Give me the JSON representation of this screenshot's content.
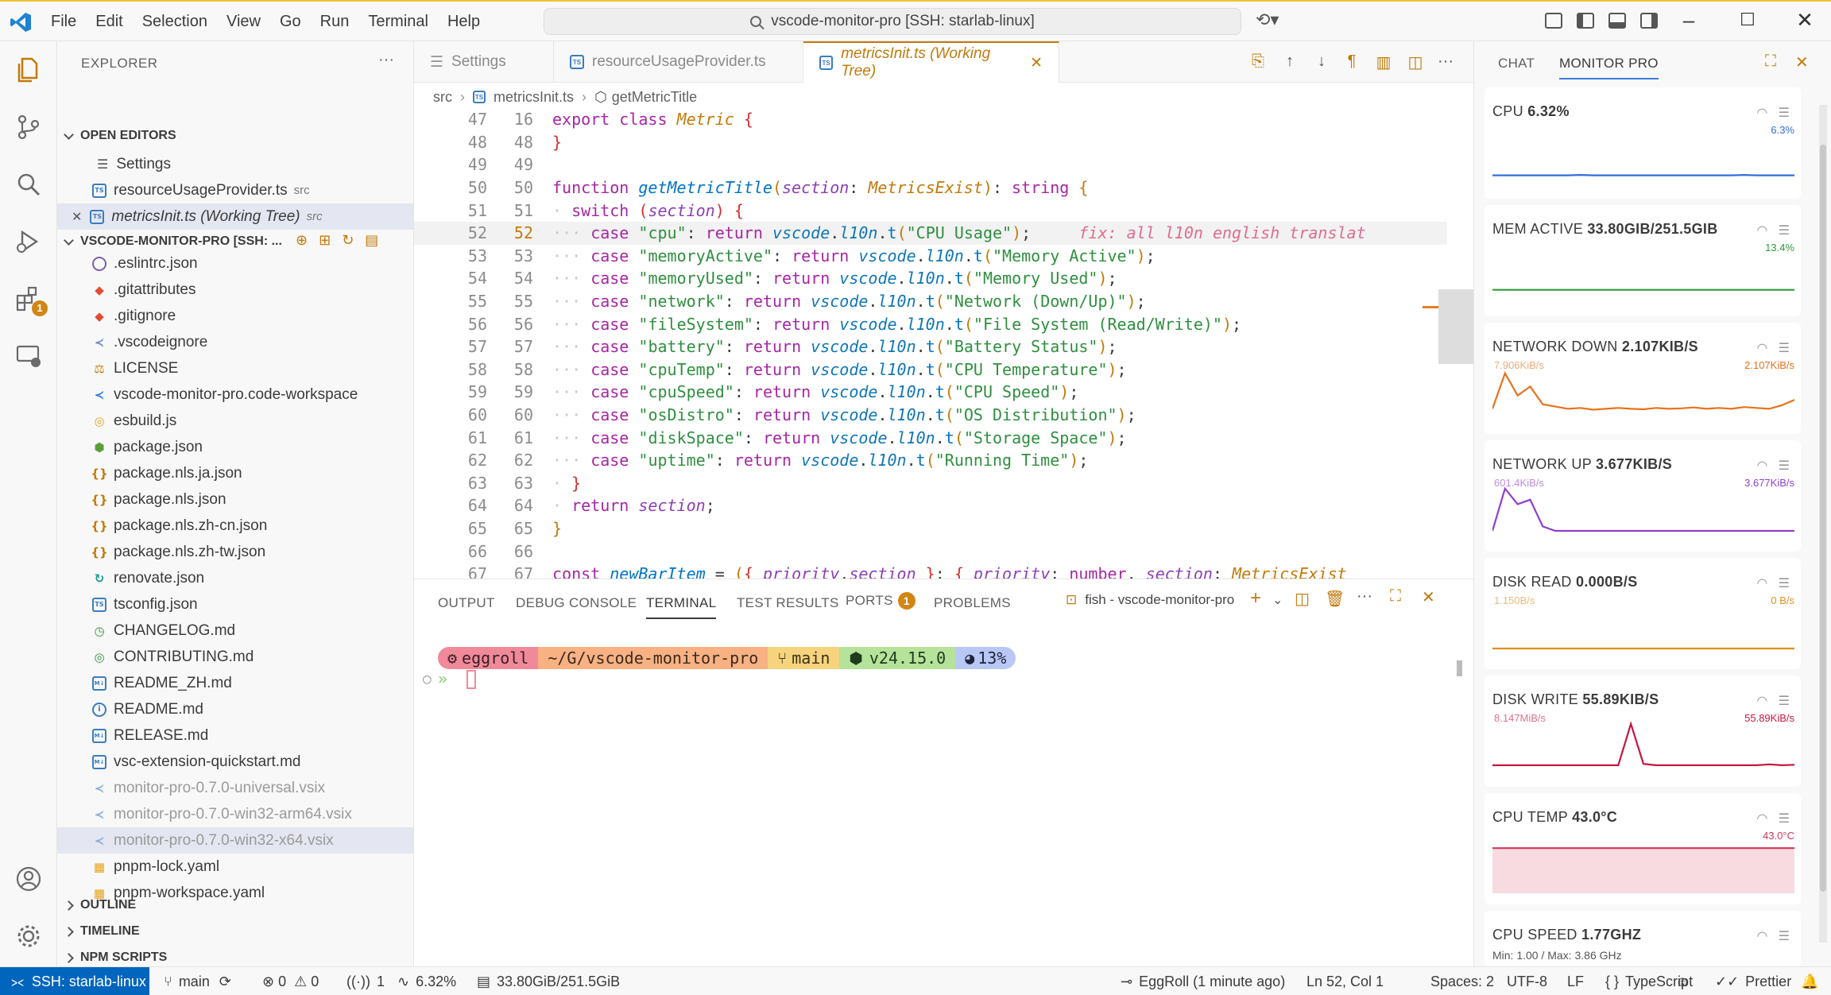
{
  "titlebar": {
    "menu": [
      "File",
      "Edit",
      "Selection",
      "View",
      "Go",
      "Run",
      "Terminal",
      "Help"
    ],
    "command_center": "vscode-monitor-pro [SSH: starlab-linux]"
  },
  "activity": {
    "extensions_badge": "1"
  },
  "explorer": {
    "title": "EXPLORER",
    "open_editors_label": "OPEN EDITORS",
    "open_editors": [
      {
        "name": "Settings",
        "desc": ""
      },
      {
        "name": "resourceUsageProvider.ts",
        "desc": "src"
      },
      {
        "name": "metricsInit.ts (Working Tree)",
        "desc": "src"
      }
    ],
    "workspace_label": "VSCODE-MONITOR-PRO [SSH: ...",
    "files": [
      {
        "name": ".eslintrc.json",
        "icon": "eslint-icon",
        "glyph": "",
        "color": "#7b5ea7"
      },
      {
        "name": ".gitattributes",
        "icon": "git-icon",
        "glyph": "◆",
        "color": "#e44c30"
      },
      {
        "name": ".gitignore",
        "icon": "git-icon",
        "glyph": "◆",
        "color": "#e44c30"
      },
      {
        "name": ".vscodeignore",
        "icon": "vscode-icon",
        "glyph": "≺",
        "color": "#6c8ebf"
      },
      {
        "name": "LICENSE",
        "icon": "license-icon",
        "glyph": "⚖",
        "color": "#c27a0a"
      },
      {
        "name": "vscode-monitor-pro.code-workspace",
        "icon": "vscode-icon",
        "glyph": "≺",
        "color": "#2f7fd8"
      },
      {
        "name": "esbuild.js",
        "icon": "esbuild-icon",
        "glyph": "◎",
        "color": "#e3a21a"
      },
      {
        "name": "package.json",
        "icon": "nodejs-icon",
        "glyph": "⬢",
        "color": "#5a9e3a"
      },
      {
        "name": "package.nls.ja.json",
        "icon": "json-icon",
        "glyph": "{}",
        "color": "#c27a0a"
      },
      {
        "name": "package.nls.json",
        "icon": "json-icon",
        "glyph": "{}",
        "color": "#c27a0a"
      },
      {
        "name": "package.nls.zh-cn.json",
        "icon": "json-icon",
        "glyph": "{}",
        "color": "#c27a0a"
      },
      {
        "name": "package.nls.zh-tw.json",
        "icon": "json-icon",
        "glyph": "{}",
        "color": "#c27a0a"
      },
      {
        "name": "renovate.json",
        "icon": "renovate-icon",
        "glyph": "↻",
        "color": "#1a9b8f"
      },
      {
        "name": "tsconfig.json",
        "icon": "ts-icon",
        "glyph": "TS",
        "color": "#3a7dbf"
      },
      {
        "name": "CHANGELOG.md",
        "icon": "changelog-icon",
        "glyph": "◷",
        "color": "#2f8f3f"
      },
      {
        "name": "CONTRIBUTING.md",
        "icon": "contributing-icon",
        "glyph": "◎",
        "color": "#2f8f3f"
      },
      {
        "name": "README_ZH.md",
        "icon": "markdown-icon",
        "glyph": "M↓",
        "color": "#3a7dbf"
      },
      {
        "name": "README.md",
        "icon": "info-icon",
        "glyph": "i",
        "color": "#3a7dbf"
      },
      {
        "name": "RELEASE.md",
        "icon": "markdown-icon",
        "glyph": "M↓",
        "color": "#3a7dbf"
      },
      {
        "name": "vsc-extension-quickstart.md",
        "icon": "markdown-icon",
        "glyph": "M↓",
        "color": "#3a7dbf"
      },
      {
        "name": "monitor-pro-0.7.0-universal.vsix",
        "icon": "vscode-icon",
        "glyph": "≺",
        "color": "#8aaed6",
        "dim": true
      },
      {
        "name": "monitor-pro-0.7.0-win32-arm64.vsix",
        "icon": "vscode-icon",
        "glyph": "≺",
        "color": "#8aaed6",
        "dim": true
      },
      {
        "name": "monitor-pro-0.7.0-win32-x64.vsix",
        "icon": "vscode-icon",
        "glyph": "≺",
        "color": "#8aaed6",
        "dim": true,
        "selected": true
      },
      {
        "name": "pnpm-lock.yaml",
        "icon": "pnpm-icon",
        "glyph": "▦",
        "color": "#e3a21a"
      },
      {
        "name": "pnpm-workspace.yaml",
        "icon": "pnpm-icon",
        "glyph": "▦",
        "color": "#e3a21a"
      }
    ],
    "outline": "OUTLINE",
    "timeline": "TIMELINE",
    "npm_scripts": "NPM SCRIPTS"
  },
  "tabs": [
    {
      "label": "Settings",
      "active": false
    },
    {
      "label": "resourceUsageProvider.ts",
      "active": false
    },
    {
      "label": "metricsInit.ts (Working Tree)",
      "active": true
    }
  ],
  "breadcrumb": [
    "src",
    "metricsInit.ts",
    "getMetricTitle"
  ],
  "code": {
    "left_numbers": [
      "47",
      "48",
      "49",
      "50",
      "51",
      "52",
      "53",
      "54",
      "55",
      "56",
      "57",
      "58",
      "59",
      "60",
      "61",
      "62",
      "63",
      "64",
      "65",
      "66",
      "67"
    ],
    "right_numbers": [
      "16",
      "48",
      "49",
      "50",
      "51",
      "52",
      "53",
      "54",
      "55",
      "56",
      "57",
      "58",
      "59",
      "60",
      "61",
      "62",
      "63",
      "64",
      "65",
      "66",
      "67"
    ],
    "cases": [
      {
        "key": "\"cpu\"",
        "label": "\"CPU Usage\""
      },
      {
        "key": "\"memoryActive\"",
        "label": "\"Memory Active\""
      },
      {
        "key": "\"memoryUsed\"",
        "label": "\"Memory Used\""
      },
      {
        "key": "\"network\"",
        "label": "\"Network (Down/Up)\""
      },
      {
        "key": "\"fileSystem\"",
        "label": "\"File System (Read/Write)\""
      },
      {
        "key": "\"battery\"",
        "label": "\"Battery Status\""
      },
      {
        "key": "\"cpuTemp\"",
        "label": "\"CPU Temperature\""
      },
      {
        "key": "\"cpuSpeed\"",
        "label": "\"CPU Speed\""
      },
      {
        "key": "\"osDistro\"",
        "label": "\"OS Distribution\""
      },
      {
        "key": "\"diskSpace\"",
        "label": "\"Storage Space\""
      },
      {
        "key": "\"uptime\"",
        "label": "\"Running Time\""
      }
    ],
    "inline_hint": "fix: all l10n english translat"
  },
  "panel": {
    "tabs": [
      "OUTPUT",
      "DEBUG CONSOLE",
      "TERMINAL",
      "TEST RESULTS",
      "PORTS",
      "PROBLEMS"
    ],
    "active_tab": "TERMINAL",
    "ports_badge": "1",
    "terminal_name": "fish - vscode-monitor-pro",
    "prompt": {
      "user": "eggroll",
      "path": "~/G/vscode-monitor-pro",
      "branch": "main",
      "node": "v24.15.0",
      "battery": "13%"
    }
  },
  "aux": {
    "tabs": [
      "CHAT",
      "MONITOR PRO"
    ],
    "metrics": [
      {
        "name": "CPU",
        "value": "6.32%",
        "left": "",
        "right": "6.3%",
        "color": "#2f6fdb",
        "series": [
          0.06,
          0.06,
          0.06,
          0.06,
          0.06,
          0.06,
          0.06,
          0.07,
          0.06,
          0.06,
          0.06,
          0.06,
          0.06,
          0.06,
          0.06,
          0.06,
          0.06,
          0.06,
          0.06,
          0.06,
          0.07,
          0.06,
          0.06,
          0.06,
          0.06
        ]
      },
      {
        "name": "MEM ACTIVE",
        "value": "33.80GIB/251.5GIB",
        "left": "",
        "right": "13.4%",
        "color": "#2f9a3a",
        "series": [
          0.13,
          0.13,
          0.13,
          0.13,
          0.13,
          0.13,
          0.13,
          0.13,
          0.13,
          0.13,
          0.13,
          0.13,
          0.13,
          0.13,
          0.13,
          0.13,
          0.13,
          0.13,
          0.13,
          0.13,
          0.13,
          0.13,
          0.13,
          0.13,
          0.13
        ]
      },
      {
        "name": "NETWORK DOWN",
        "value": "2.107KIB/S",
        "left": "7.906KiB/s",
        "right": "2.107KiB/s",
        "color": "#e8711c",
        "series": [
          0.1,
          0.9,
          0.4,
          0.6,
          0.2,
          0.15,
          0.1,
          0.12,
          0.08,
          0.1,
          0.12,
          0.1,
          0.09,
          0.12,
          0.1,
          0.11,
          0.13,
          0.1,
          0.12,
          0.1,
          0.14,
          0.12,
          0.1,
          0.18,
          0.3
        ]
      },
      {
        "name": "NETWORK UP",
        "value": "3.677KIB/S",
        "left": "601.4KiB/s",
        "right": "3.677KiB/s",
        "color": "#8e3fd0",
        "series": [
          0.0,
          0.95,
          0.6,
          0.7,
          0.1,
          0.0,
          0.0,
          0.0,
          0.0,
          0.0,
          0.0,
          0.0,
          0.0,
          0.0,
          0.0,
          0.0,
          0.0,
          0.0,
          0.0,
          0.0,
          0.0,
          0.0,
          0.0,
          0.0,
          0.0
        ]
      },
      {
        "name": "DISK READ",
        "value": "0.000B/S",
        "left": "1.150B/s",
        "right": "0 B/s",
        "color": "#e0901c",
        "series": [
          0,
          0,
          0,
          0,
          0,
          0,
          0,
          0,
          0,
          0,
          0,
          0,
          0,
          0,
          0,
          0,
          0,
          0,
          0,
          0,
          0,
          0,
          0,
          0,
          0
        ]
      },
      {
        "name": "DISK WRITE",
        "value": "55.89KIB/S",
        "left": "8.147MiB/s",
        "right": "55.89KiB/s",
        "color": "#c4163e",
        "series": [
          0.02,
          0.02,
          0.02,
          0.02,
          0.02,
          0.02,
          0.02,
          0.02,
          0.02,
          0.02,
          0.02,
          0.95,
          0.05,
          0.02,
          0.02,
          0.02,
          0.02,
          0.02,
          0.02,
          0.02,
          0.02,
          0.02,
          0.04,
          0.02,
          0.03
        ]
      },
      {
        "name": "CPU TEMP",
        "value": "43.0°C",
        "left": "",
        "right": "43.0°C",
        "color": "#d4365a",
        "series": [
          0.8,
          0.8,
          0.8,
          0.8,
          0.8,
          0.8,
          0.8,
          0.8,
          0.8,
          0.8,
          0.8,
          0.8,
          0.8,
          0.8,
          0.8,
          0.8,
          0.8,
          0.8,
          0.8,
          0.8,
          0.8,
          0.8,
          0.8,
          0.8,
          0.8
        ]
      },
      {
        "name": "CPU SPEED",
        "value": "1.77GHZ",
        "left": "Min: 1.00 / Max: 3.86 GHz",
        "right": "",
        "color": "#3b7ddd",
        "series": []
      }
    ]
  },
  "status": {
    "remote": "SSH: starlab-linux",
    "branch": "main",
    "errors": "0",
    "warnings": "0",
    "ports": "1",
    "cpu": "6.32%",
    "mem": "33.80GiB/251.5GiB",
    "blame": "EggRoll (1 minute ago)",
    "position": "Ln 52, Col 1",
    "spaces": "Spaces: 2",
    "encoding": "UTF-8",
    "eol": "LF",
    "language": "TypeScript",
    "formatter": "Prettier"
  }
}
